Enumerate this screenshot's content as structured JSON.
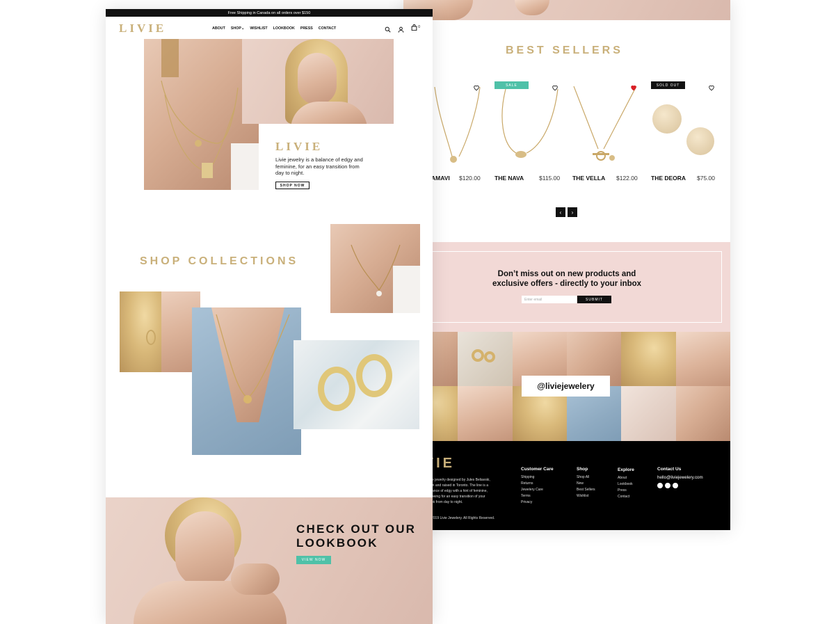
{
  "brand": "LIVIE",
  "colors": {
    "gold": "#c9b07a",
    "teal": "#4fc1a8",
    "pink": "#f2d9d6",
    "black": "#111111",
    "heart_red": "#d91f26"
  },
  "left_page": {
    "announcement": "Free Shipping in Canada on all orders over $150",
    "nav": {
      "items": [
        "ABOUT",
        "SHOP",
        "WISHLIST",
        "LOOKBOOK",
        "PRESS",
        "CONTACT"
      ],
      "cart_count": "0",
      "icons": [
        "search-icon",
        "account-icon",
        "bag-icon"
      ]
    },
    "hero": {
      "title": "LIVIE",
      "description": "Livie jewelry is a balance of edgy and feminine, for an easy transition from day to night.",
      "button": "SHOP NOW"
    },
    "collections": {
      "title": "SHOP COLLECTIONS"
    },
    "lookbook": {
      "title_line1": "CHECK OUT OUR",
      "title_line2": "LOOKBOOK",
      "button": "VIEW NOW"
    }
  },
  "right_page": {
    "best_sellers": {
      "title": "BEST SELLERS",
      "products": [
        {
          "name": "AMAVI",
          "price": "$120.00",
          "badge": "",
          "wishlisted": false
        },
        {
          "name": "THE NAVA",
          "price": "$115.00",
          "badge": "SALE",
          "wishlisted": false
        },
        {
          "name": "THE VELLA",
          "price": "$122.00",
          "badge": "",
          "wishlisted": true
        },
        {
          "name": "THE DEORA",
          "price": "$75.00",
          "badge": "SOLD OUT",
          "wishlisted": false
        }
      ]
    },
    "newsletter": {
      "line1": "Don’t miss out on new products and",
      "line2": "exclusive offers - directly to your inbox",
      "placeholder": "Enter email",
      "button": "SUBMIT"
    },
    "instagram": {
      "handle": "@liviejewelery"
    },
    "footer": {
      "logo": "LIVIE",
      "about_lines": [
        "le jewelry designed by Jules Beliavski,",
        "rn and raised in Toronto. The line is a",
        "lance of edgy with a hint of feminine,",
        "owing for an easy transition of your",
        "ok from day to night."
      ],
      "copyright": "2019 Livie Jewelery.  All Rights Reserved.",
      "customer_care": {
        "heading": "Customer Care",
        "links": [
          "Shipping",
          "Returns",
          "Jewelery Care",
          "Terms",
          "Privacy"
        ]
      },
      "shop": {
        "heading": "Shop",
        "links": [
          "Shop All",
          "New",
          "Best Sellers",
          "Wishlist"
        ]
      },
      "explore": {
        "heading": "Explore",
        "links": [
          "About",
          "Lookbook",
          "Press",
          "Contact"
        ]
      },
      "contact": {
        "heading": "Contact Us",
        "email": "hello@liviejewelery.com",
        "social_icons": [
          "facebook-icon",
          "instagram-icon",
          "twitter-icon"
        ]
      }
    }
  }
}
